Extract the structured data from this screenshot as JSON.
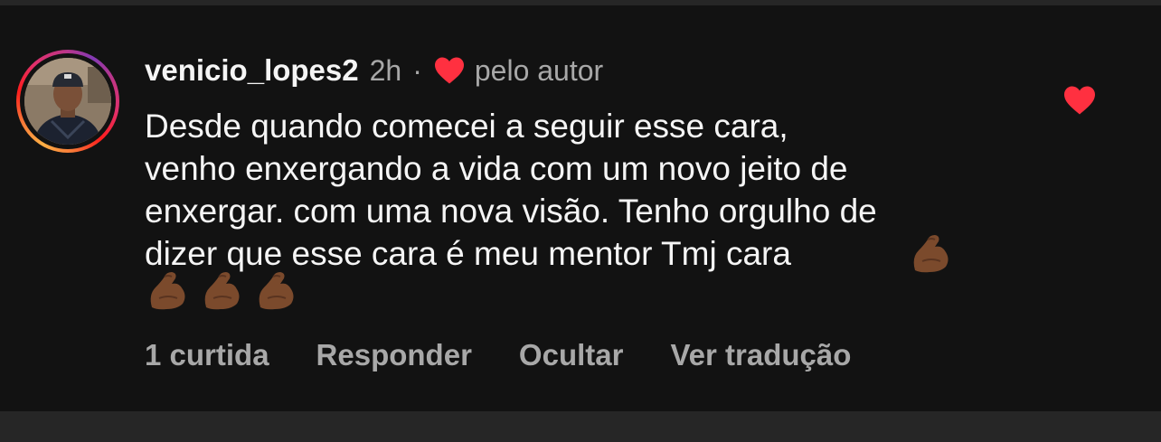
{
  "comment": {
    "username": "venicio_lopes2",
    "time": "2h",
    "separator": "·",
    "author_like_label": "pelo autor",
    "text": "Desde quando comecei a seguir esse cara,\nvenho enxergando a vida com um novo jeito de\nenxergar. com uma nova visão. Tenho orgulho de\ndizer que esse cara é meu mentor Tmj cara",
    "emoji_inline": "flexed-biceps-medium-dark-skin",
    "emoji_trailing": [
      "flexed-biceps-medium-dark-skin",
      "flexed-biceps-medium-dark-skin",
      "flexed-biceps-medium-dark-skin"
    ],
    "liked": true
  },
  "actions": {
    "likes_count": "1 curtida",
    "reply": "Responder",
    "hide": "Ocultar",
    "translate": "Ver tradução"
  },
  "colors": {
    "background": "#121212",
    "text": "#f5f5f5",
    "secondary": "#a8a8a8",
    "heart": "#ff3040"
  },
  "icons": {
    "author_heart": "heart-icon",
    "like_heart": "heart-filled-icon",
    "emoji": "flexed-biceps-emoji"
  }
}
